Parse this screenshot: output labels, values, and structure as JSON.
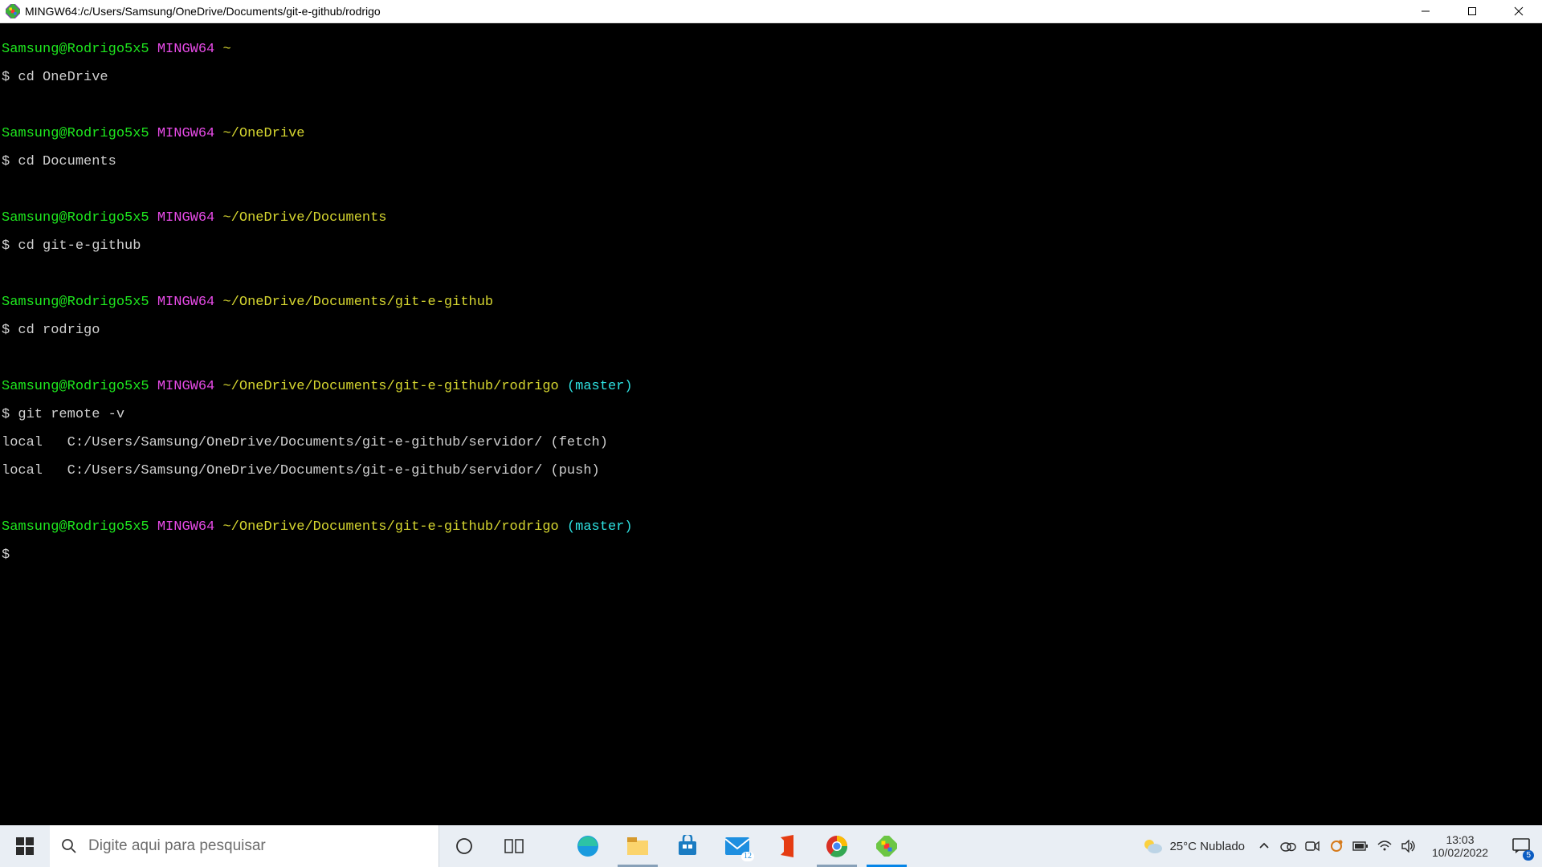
{
  "window": {
    "title": "MINGW64:/c/Users/Samsung/OneDrive/Documents/git-e-github/rodrigo"
  },
  "colors": {
    "prompt_userhost": "#1ee61e",
    "prompt_mingw": "#e84be8",
    "prompt_path": "#d6d630",
    "prompt_branch": "#2ee2e2",
    "text": "#d0d0d0",
    "terminal_bg": "#000000"
  },
  "term": {
    "userhost": "Samsung@Rodrigo5x5",
    "mingw": "MINGW64",
    "tilde": "~",
    "path_onedrive": "~/OneDrive",
    "path_docs": "~/OneDrive/Documents",
    "path_git": "~/OneDrive/Documents/git-e-github",
    "path_rodrigo": "~/OneDrive/Documents/git-e-github/rodrigo",
    "branch": "(master)",
    "cmd1": "$ cd OneDrive",
    "cmd2": "$ cd Documents",
    "cmd3": "$ cd git-e-github",
    "cmd4": "$ cd rodrigo",
    "cmd5": "$ git remote -v",
    "out1": "local   C:/Users/Samsung/OneDrive/Documents/git-e-github/servidor/ (fetch)",
    "out2": "local   C:/Users/Samsung/OneDrive/Documents/git-e-github/servidor/ (push)",
    "cmd6": "$"
  },
  "taskbar": {
    "search_placeholder": "Digite aqui para pesquisar",
    "weather": "25°C  Nublado",
    "mail_badge": "12",
    "notif_badge": "5",
    "clock_time": "13:03",
    "clock_date": "10/02/2022"
  }
}
